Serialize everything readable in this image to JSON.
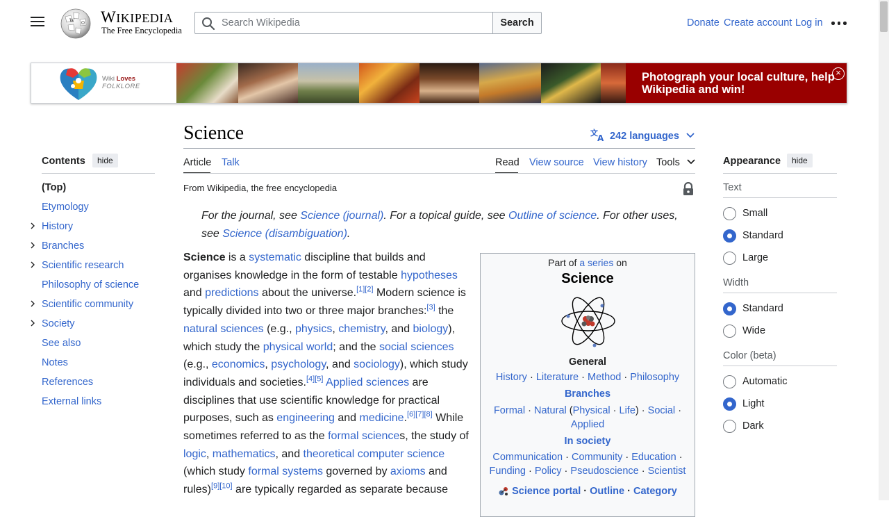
{
  "header": {
    "wordmark_w": "W",
    "wordmark_rest": "IKIPEDIA",
    "tagline": "The Free Encyclopedia",
    "search_placeholder": "Search Wikipedia",
    "search_button": "Search",
    "donate": "Donate",
    "create_account": "Create account",
    "log_in": "Log in"
  },
  "banner": {
    "logo_wiki": "Wiki",
    "logo_loves": "Loves",
    "logo_folklore": "FOLKLORE",
    "cta": "Photograph your local culture, help Wikipedia and win!",
    "close": "×"
  },
  "article": {
    "title": "Science",
    "languages": "242 languages",
    "tabs": {
      "article": "Article",
      "talk": "Talk",
      "read": "Read",
      "view_source": "View source",
      "view_history": "View history",
      "tools": "Tools"
    },
    "from": "From Wikipedia, the free encyclopedia",
    "hatnote": {
      "t1": "For the journal, see ",
      "l1": "Science (journal)",
      "t2": ". For a topical guide, see ",
      "l2": "Outline of science",
      "t3": ". For other uses, see ",
      "l3": "Science (disambiguation)",
      "t4": "."
    },
    "lead": [
      {
        "b": "Science"
      },
      {
        "t": " is a "
      },
      {
        "a": "systematic"
      },
      {
        "t": " discipline that builds and organises knowledge in the form of testable "
      },
      {
        "a": "hypotheses"
      },
      {
        "t": " and "
      },
      {
        "a": "predictions"
      },
      {
        "t": " about the universe."
      },
      {
        "s": "[1]"
      },
      {
        "s": "[2]"
      },
      {
        "t": " Modern science is typically divided into two or three major branches:"
      },
      {
        "s": "[3]"
      },
      {
        "t": " the "
      },
      {
        "a": "natural sciences"
      },
      {
        "t": " (e.g., "
      },
      {
        "a": "physics"
      },
      {
        "t": ", "
      },
      {
        "a": "chemistry"
      },
      {
        "t": ", and "
      },
      {
        "a": "biology"
      },
      {
        "t": "), which study the "
      },
      {
        "a": "physical world"
      },
      {
        "t": "; and the "
      },
      {
        "a": "social sciences"
      },
      {
        "t": " (e.g., "
      },
      {
        "a": "economics"
      },
      {
        "t": ", "
      },
      {
        "a": "psychology"
      },
      {
        "t": ", and "
      },
      {
        "a": "sociology"
      },
      {
        "t": "), which study individuals and societies."
      },
      {
        "s": "[4]"
      },
      {
        "s": "[5]"
      },
      {
        "t": " "
      },
      {
        "a": "Applied sciences"
      },
      {
        "t": " are disciplines that use scientific knowledge for practical purposes, such as "
      },
      {
        "a": "engineering"
      },
      {
        "t": " and "
      },
      {
        "a": "medicine"
      },
      {
        "t": "."
      },
      {
        "s": "[6]"
      },
      {
        "s": "[7]"
      },
      {
        "s": "[8]"
      },
      {
        "t": " While sometimes referred to as the "
      },
      {
        "a": "formal science"
      },
      {
        "t": "s, the study of "
      },
      {
        "a": "logic"
      },
      {
        "t": ", "
      },
      {
        "a": "mathematics"
      },
      {
        "t": ", and "
      },
      {
        "a": "theoretical computer science"
      },
      {
        "t": " (which study "
      },
      {
        "a": "formal systems"
      },
      {
        "t": " governed by "
      },
      {
        "a": "axioms"
      },
      {
        "t": " and rules)"
      },
      {
        "s": "[9]"
      },
      {
        "s": "[10]"
      },
      {
        "t": " are typically regarded as separate because"
      }
    ]
  },
  "toc": {
    "heading": "Contents",
    "hide": "hide",
    "items": [
      {
        "label": "(Top)",
        "expandable": false
      },
      {
        "label": "Etymology",
        "expandable": false
      },
      {
        "label": "History",
        "expandable": true
      },
      {
        "label": "Branches",
        "expandable": true
      },
      {
        "label": "Scientific research",
        "expandable": true
      },
      {
        "label": "Philosophy of science",
        "expandable": false
      },
      {
        "label": "Scientific community",
        "expandable": true
      },
      {
        "label": "Society",
        "expandable": true
      },
      {
        "label": "See also",
        "expandable": false
      },
      {
        "label": "Notes",
        "expandable": false
      },
      {
        "label": "References",
        "expandable": false
      },
      {
        "label": "External links",
        "expandable": false
      }
    ]
  },
  "appearance": {
    "heading": "Appearance",
    "hide": "hide",
    "text_label": "Text",
    "text_options": [
      {
        "label": "Small",
        "selected": false
      },
      {
        "label": "Standard",
        "selected": true
      },
      {
        "label": "Large",
        "selected": false
      }
    ],
    "width_label": "Width",
    "width_options": [
      {
        "label": "Standard",
        "selected": true
      },
      {
        "label": "Wide",
        "selected": false
      }
    ],
    "color_label": "Color (beta)",
    "color_options": [
      {
        "label": "Automatic",
        "selected": false
      },
      {
        "label": "Light",
        "selected": true
      },
      {
        "label": "Dark",
        "selected": false
      }
    ]
  },
  "infobox": {
    "part_of": "Part of ",
    "a_series": "a series",
    "on": " on",
    "title": "Science",
    "general": "General",
    "general_links": [
      "History",
      "Literature",
      "Method",
      "Philosophy"
    ],
    "branches": "Branches",
    "formal": "Formal",
    "natural": "Natural",
    "physical": "Physical",
    "life": "Life",
    "social": "Social",
    "applied": "Applied",
    "in_society": "In society",
    "society_links": [
      "Communication",
      "Community",
      "Education",
      "Funding",
      "Policy",
      "Pseudoscience",
      "Scientist"
    ],
    "portal_links": [
      "Science portal",
      "Outline",
      "Category"
    ]
  },
  "colors": {
    "link": "#3366cc",
    "text": "#202122",
    "banner_cta_bg": "#990000",
    "radio_selected": "#3366cc"
  }
}
